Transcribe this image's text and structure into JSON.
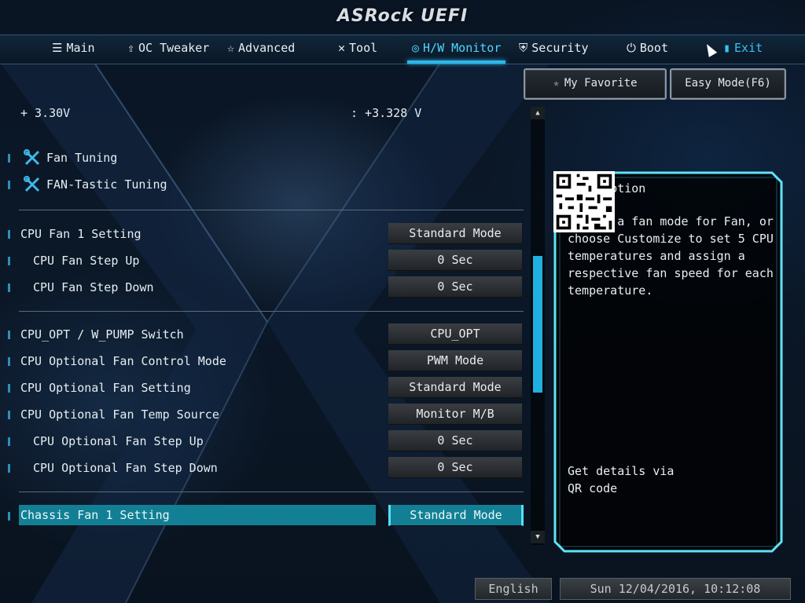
{
  "header": {
    "logo": "ASRock UEFI"
  },
  "nav": {
    "tabs": [
      {
        "label": "Main",
        "icon": "list-icon"
      },
      {
        "label": "OC Tweaker",
        "icon": "rocket-icon"
      },
      {
        "label": "Advanced",
        "icon": "star-icon"
      },
      {
        "label": "Tool",
        "icon": "tools-icon"
      },
      {
        "label": "H/W Monitor",
        "icon": "monitor-icon",
        "active": true
      },
      {
        "label": "Security",
        "icon": "shield-icon"
      },
      {
        "label": "Boot",
        "icon": "power-icon"
      },
      {
        "label": "Exit",
        "icon": "door-icon"
      }
    ]
  },
  "buttons": {
    "favorite": "My Favorite",
    "easy_mode": "Easy Mode(F6)"
  },
  "voltage": {
    "label": "+ 3.30V",
    "value": ": +3.328 V"
  },
  "tools": {
    "fan_tuning": "Fan Tuning",
    "fantastic_tuning": "FAN-Tastic Tuning"
  },
  "settings": {
    "cpu_fan1": {
      "label": "CPU Fan 1 Setting",
      "value": "Standard Mode"
    },
    "cpu_fan_step_up": {
      "label": "CPU Fan Step Up",
      "value": "0 Sec"
    },
    "cpu_fan_step_down": {
      "label": "CPU Fan Step Down",
      "value": "0 Sec"
    },
    "cpu_opt_switch": {
      "label": "CPU_OPT / W_PUMP Switch",
      "value": "CPU_OPT"
    },
    "cpu_opt_control_mode": {
      "label": "CPU Optional Fan Control Mode",
      "value": "PWM Mode"
    },
    "cpu_opt_setting": {
      "label": "CPU Optional Fan Setting",
      "value": "Standard Mode"
    },
    "cpu_opt_temp_source": {
      "label": "CPU Optional Fan Temp Source",
      "value": "Monitor M/B"
    },
    "cpu_opt_step_up": {
      "label": "CPU Optional Fan Step Up",
      "value": "0 Sec"
    },
    "cpu_opt_step_down": {
      "label": "CPU Optional Fan Step Down",
      "value": "0 Sec"
    },
    "chassis_fan1": {
      "label": "Chassis Fan 1 Setting",
      "value": "Standard Mode"
    }
  },
  "description": {
    "title": "Description",
    "body": "Select a fan mode for Fan, or choose Customize to set 5 CPU temperatures and assign a respective fan speed for each temperature.",
    "qr_text": "Get details via QR code"
  },
  "footer": {
    "language": "English",
    "datetime": "Sun 12/04/2016, 10:12:08"
  },
  "colors": {
    "accent": "#2fb7e8",
    "selected_row": "#137f94"
  }
}
